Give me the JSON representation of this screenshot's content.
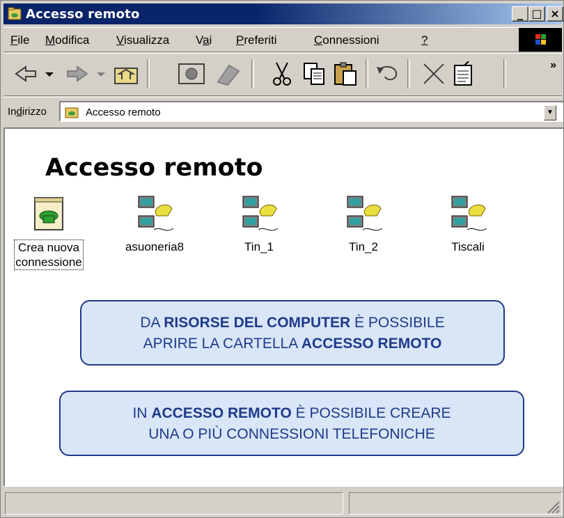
{
  "window": {
    "title": "Accesso remoto"
  },
  "title_buttons": {
    "minimize": "_",
    "maximize": "□",
    "close": "×"
  },
  "menu": [
    {
      "pre": "",
      "u": "F",
      "post": "ile"
    },
    {
      "pre": "",
      "u": "M",
      "post": "odifica"
    },
    {
      "pre": "",
      "u": "V",
      "post": "isualizza"
    },
    {
      "pre": "V",
      "u": "a",
      "post": "i"
    },
    {
      "pre": "",
      "u": "P",
      "post": "referiti"
    },
    {
      "pre": "",
      "u": "C",
      "post": "onnessioni"
    },
    {
      "pre": "",
      "u": "?",
      "post": ""
    }
  ],
  "toolbar": {
    "more": "»",
    "icons": [
      "back-icon",
      "forward-icon",
      "up-folder-icon",
      "map-drive-icon",
      "disconnect-drive-icon",
      "cut-icon",
      "copy-icon",
      "paste-icon",
      "undo-icon",
      "delete-icon",
      "properties-icon"
    ]
  },
  "address": {
    "label_pre": "In",
    "label_u": "d",
    "label_post": "irizzo",
    "value": "Accesso remoto"
  },
  "content": {
    "folder_title": "Accesso remoto",
    "items": [
      {
        "label1": "Crea nuova",
        "label2": "connessione",
        "icon": "make-new-connection-icon"
      },
      {
        "label1": "asuoneria8",
        "label2": "",
        "icon": "dialup-connection-icon"
      },
      {
        "label1": "Tin_1",
        "label2": "",
        "icon": "dialup-connection-icon"
      },
      {
        "label1": "Tin_2",
        "label2": "",
        "icon": "dialup-connection-icon"
      },
      {
        "label1": "Tiscali",
        "label2": "",
        "icon": "dialup-connection-icon"
      }
    ]
  },
  "callouts": {
    "first": {
      "t1": "DA ",
      "b1": "RISORSE DEL COMPUTER",
      "t2": " È POSSIBILE",
      "t3": "APRIRE LA CARTELLA ",
      "b2": "ACCESSO REMOTO"
    },
    "second": {
      "t1": "IN ",
      "b1": "ACCESSO REMOTO",
      "t2": " È POSSIBILE CREARE",
      "t3": "UNA O PIÙ CONNESSIONI TELEFONICHE"
    }
  },
  "colors": {
    "titlebar": "#0a246a",
    "callout_text": "#1f3a8a",
    "callout_bg": "#d9e6f7"
  }
}
